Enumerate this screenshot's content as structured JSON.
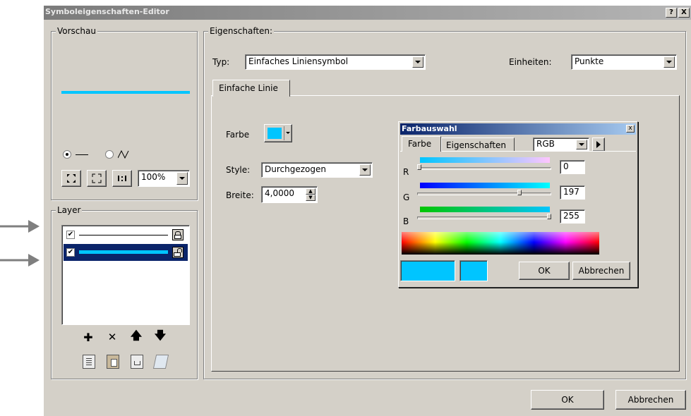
{
  "window": {
    "title": "Symboleigenschaften-Editor",
    "help": "?",
    "close": "X"
  },
  "preview": {
    "label": "Vorschau",
    "zoom": "100%"
  },
  "layer": {
    "label": "Layer"
  },
  "properties": {
    "label": "Eigenschaften:",
    "type_label": "Typ:",
    "type_value": "Einfaches Liniensymbol",
    "units_label": "Einheiten:",
    "units_value": "Punkte",
    "tab": "Einfache Linie",
    "color_label": "Farbe",
    "style_label": "Style:",
    "style_value": "Durchgezogen",
    "width_label": "Breite:",
    "width_value": "4,0000"
  },
  "color_picker": {
    "title": "Farbauswahl",
    "close": "x",
    "tab_color": "Farbe",
    "tab_props": "Eigenschaften",
    "model": "RGB",
    "r_label": "R",
    "r_value": "0",
    "g_label": "G",
    "g_value": "197",
    "b_label": "B",
    "b_value": "255",
    "ok": "OK",
    "cancel": "Abbrechen"
  },
  "footer": {
    "ok": "OK",
    "cancel": "Abbrechen"
  },
  "colors": {
    "symbol": "#00c5ff",
    "face": "#d4d0c8"
  }
}
